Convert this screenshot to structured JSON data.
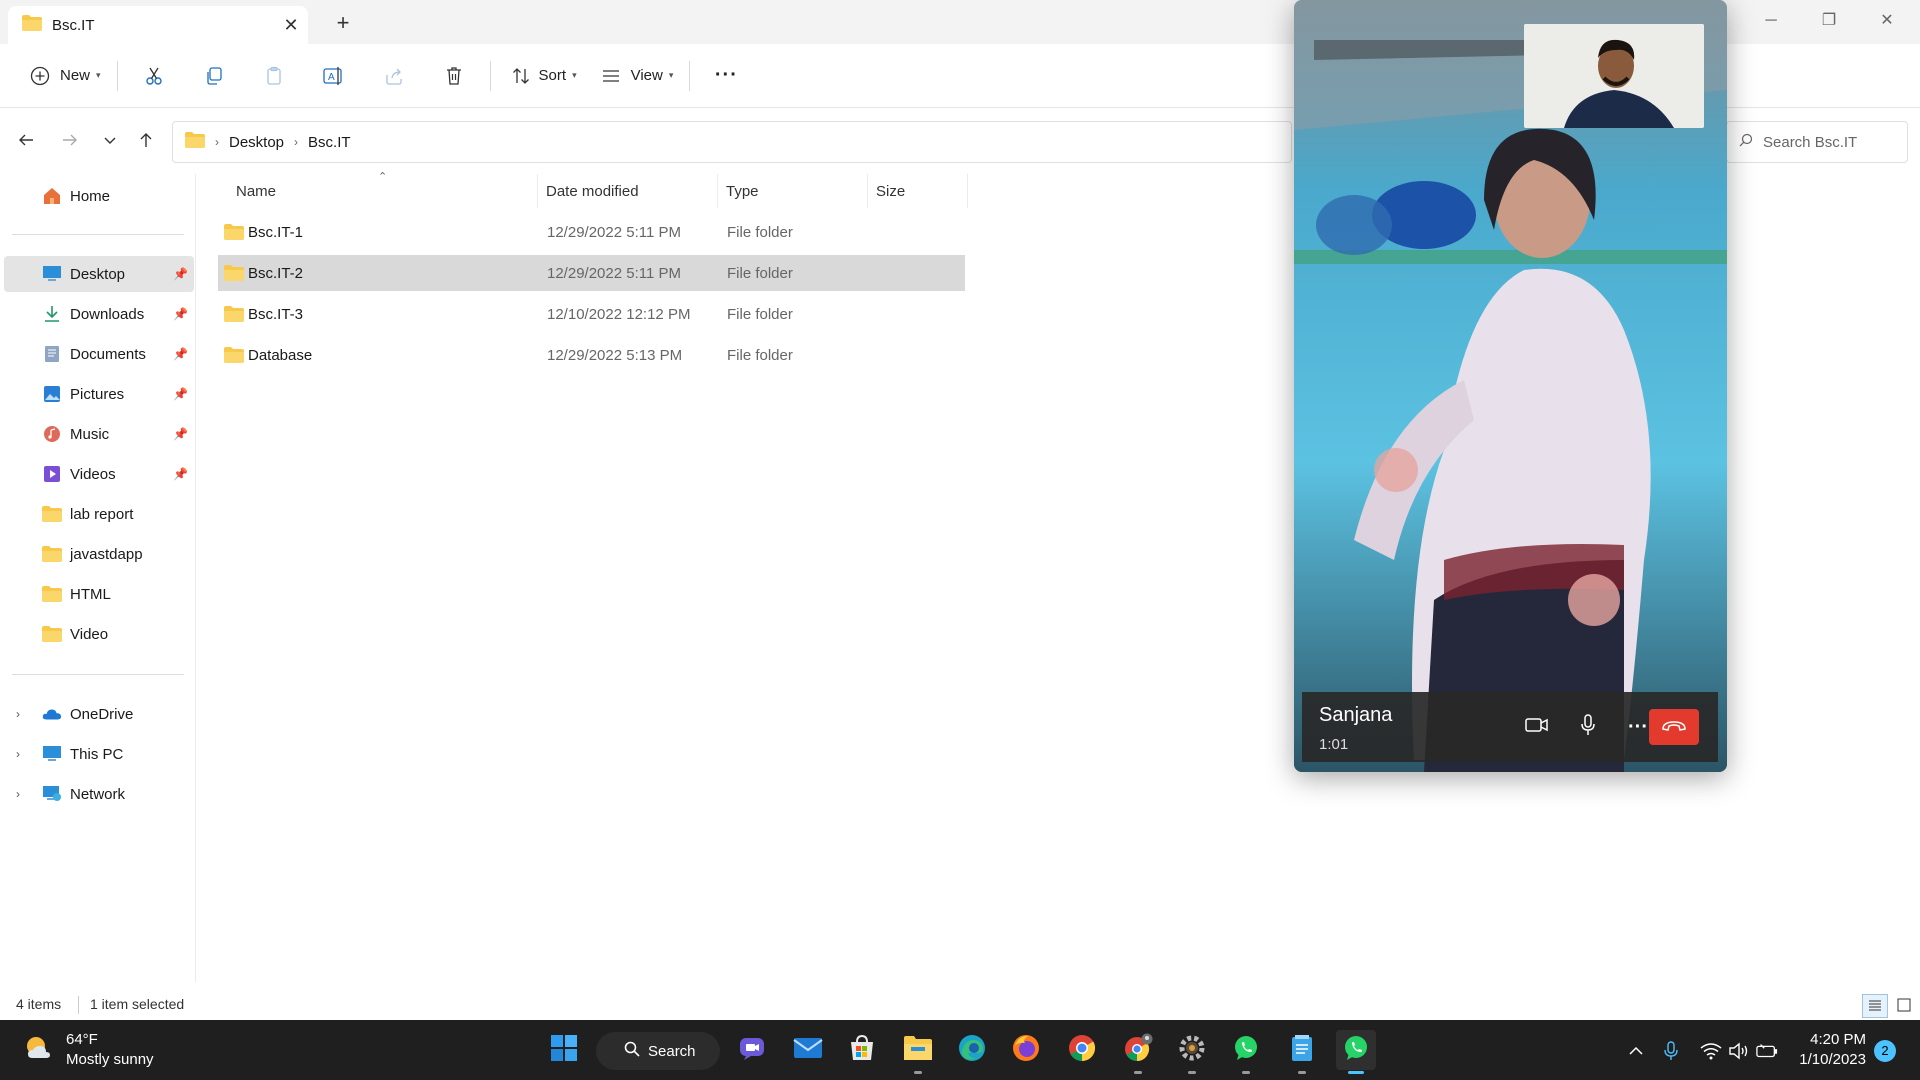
{
  "window": {
    "tab_title": "Bsc.IT",
    "tab_close": "✕",
    "new_tab": "+",
    "minimize": "─",
    "maximize": "❐",
    "close": "✕"
  },
  "command_bar": {
    "new_label": "New",
    "sort_label": "Sort",
    "view_label": "View",
    "more_label": "···"
  },
  "address": {
    "crumbs": [
      "Desktop",
      "Bsc.IT"
    ],
    "search_placeholder": "Search Bsc.IT"
  },
  "sidebar": {
    "home": "Home",
    "quick_access": [
      {
        "label": "Desktop",
        "icon": "desktop-icon",
        "pinned": true
      },
      {
        "label": "Downloads",
        "icon": "downloads-icon",
        "pinned": true
      },
      {
        "label": "Documents",
        "icon": "documents-icon",
        "pinned": true
      },
      {
        "label": "Pictures",
        "icon": "pictures-icon",
        "pinned": true
      },
      {
        "label": "Music",
        "icon": "music-icon",
        "pinned": true
      },
      {
        "label": "Videos",
        "icon": "videos-icon",
        "pinned": true
      },
      {
        "label": "lab report",
        "icon": "folder-icon",
        "pinned": false
      },
      {
        "label": "javastdapp",
        "icon": "folder-icon",
        "pinned": false
      },
      {
        "label": "HTML",
        "icon": "folder-icon",
        "pinned": false
      },
      {
        "label": "Video",
        "icon": "folder-icon",
        "pinned": false
      }
    ],
    "locations": [
      {
        "label": "OneDrive",
        "icon": "onedrive-icon"
      },
      {
        "label": "This PC",
        "icon": "this-pc-icon"
      },
      {
        "label": "Network",
        "icon": "network-icon"
      }
    ]
  },
  "file_list": {
    "columns": [
      "Name",
      "Date modified",
      "Type",
      "Size"
    ],
    "rows": [
      {
        "name": "Bsc.IT-1",
        "date": "12/29/2022 5:11 PM",
        "type": "File folder",
        "size": ""
      },
      {
        "name": "Bsc.IT-2",
        "date": "12/29/2022 5:11 PM",
        "type": "File folder",
        "size": ""
      },
      {
        "name": "Bsc.IT-3",
        "date": "12/10/2022 12:12 PM",
        "type": "File folder",
        "size": ""
      },
      {
        "name": "Database",
        "date": "12/29/2022 5:13 PM",
        "type": "File folder",
        "size": ""
      }
    ]
  },
  "status_bar": {
    "item_count": "4 items",
    "selection": "1 item selected"
  },
  "call": {
    "contact_name": "Sanjana",
    "duration": "1:01"
  },
  "taskbar": {
    "weather_temp": "64°F",
    "weather_desc": "Mostly sunny",
    "search_label": "Search",
    "time": "4:20 PM",
    "date": "1/10/2023",
    "notification_count": "2"
  },
  "colors": {
    "accent": "#0067c0",
    "folder": "#f8c84a",
    "end_call": "#e23b2e",
    "taskbar_bg": "#1f1f1f",
    "active_indicator": "#4cc2ff"
  }
}
